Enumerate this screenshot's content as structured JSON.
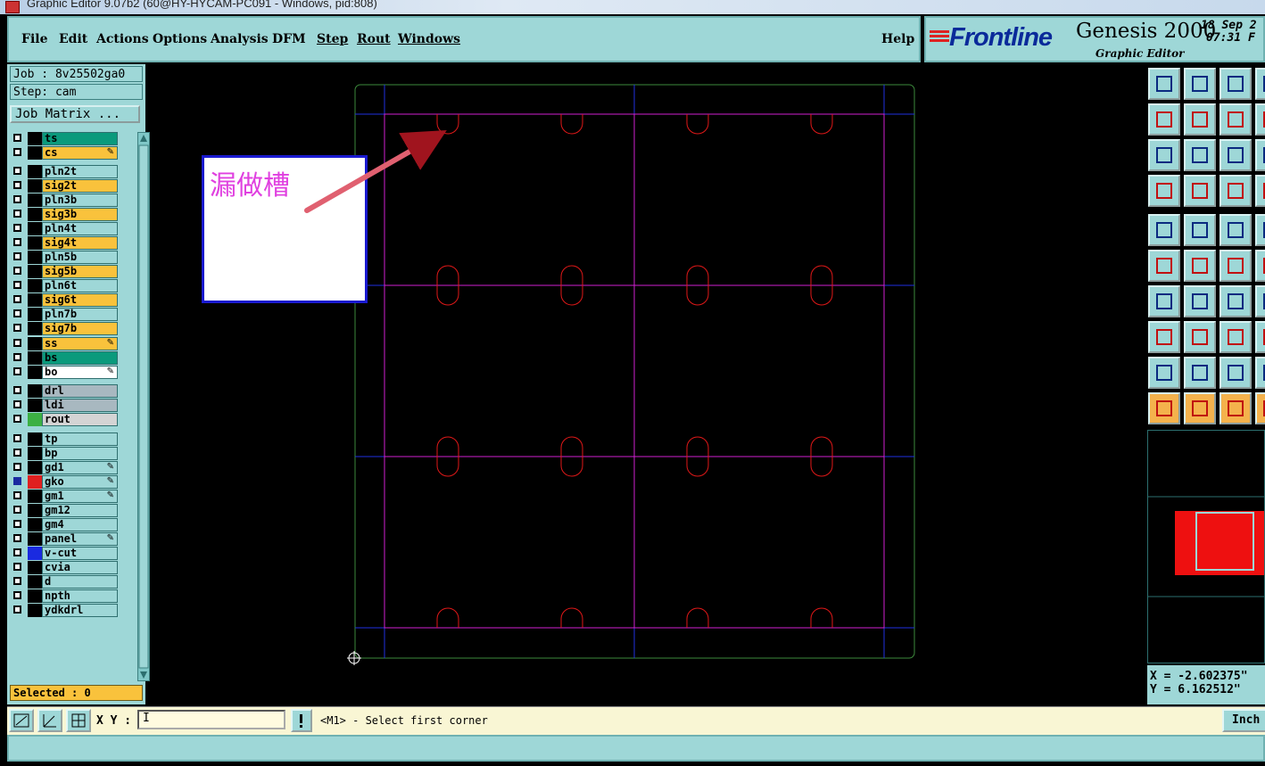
{
  "window": {
    "title": "Graphic Editor 9.07b2 (60@HY-HYCAM-PC091 - Windows, pid:808)"
  },
  "menu": {
    "items": [
      "File",
      "Edit",
      "Actions",
      "Options",
      "Analysis",
      "DFM",
      "Step",
      "Rout",
      "Windows"
    ],
    "help": "Help"
  },
  "brand": {
    "logo": "Frontline",
    "product": "Genesis 2000",
    "subtitle": "Graphic Editor",
    "date": "18 Sep 2",
    "time": "07:31 F"
  },
  "job": {
    "job": "Job : 8v25502ga0",
    "step": "Step: cam",
    "matrix_button": "Job Matrix ..."
  },
  "layers": [
    {
      "name": "ts",
      "color": "#0b9a7c"
    },
    {
      "name": "cs",
      "color": "#f9c23c",
      "edit": true
    },
    {
      "name": "pln2t",
      "color": "#9ed7d7"
    },
    {
      "name": "sig2t",
      "color": "#f9c23c"
    },
    {
      "name": "pln3b",
      "color": "#9ed7d7"
    },
    {
      "name": "sig3b",
      "color": "#f9c23c"
    },
    {
      "name": "pln4t",
      "color": "#9ed7d7"
    },
    {
      "name": "sig4t",
      "color": "#f9c23c"
    },
    {
      "name": "pln5b",
      "color": "#9ed7d7"
    },
    {
      "name": "sig5b",
      "color": "#f9c23c"
    },
    {
      "name": "pln6t",
      "color": "#9ed7d7"
    },
    {
      "name": "sig6t",
      "color": "#f9c23c"
    },
    {
      "name": "pln7b",
      "color": "#9ed7d7"
    },
    {
      "name": "sig7b",
      "color": "#f9c23c"
    },
    {
      "name": "ss",
      "color": "#f9c23c",
      "edit": true
    },
    {
      "name": "bs",
      "color": "#0b9a7c"
    },
    {
      "name": "bo",
      "color": "#ffffff",
      "edit": true
    },
    {
      "name": "drl",
      "color": "#a8b8c0"
    },
    {
      "name": "ldi",
      "color": "#a8b8c0"
    },
    {
      "name": "rout",
      "color": "#d4d4d4",
      "swatch": "#3cb043"
    },
    {
      "name": "tp",
      "color": "#9ed7d7"
    },
    {
      "name": "bp",
      "color": "#9ed7d7"
    },
    {
      "name": "gd1",
      "color": "#9ed7d7",
      "edit": true
    },
    {
      "name": "gko",
      "color": "#9ed7d7",
      "edit": true,
      "swatch": "#e02020",
      "selected": true
    },
    {
      "name": "gm1",
      "color": "#9ed7d7",
      "edit": true
    },
    {
      "name": "gm12",
      "color": "#9ed7d7"
    },
    {
      "name": "gm4",
      "color": "#9ed7d7"
    },
    {
      "name": "panel",
      "color": "#9ed7d7",
      "edit": true
    },
    {
      "name": "v-cut",
      "color": "#9ed7d7",
      "swatch": "#1a2ae0"
    },
    {
      "name": "cvia",
      "color": "#9ed7d7"
    },
    {
      "name": "d",
      "color": "#9ed7d7"
    },
    {
      "name": "npth",
      "color": "#9ed7d7"
    },
    {
      "name": "ydkdrl",
      "color": "#9ed7d7"
    }
  ],
  "selected_label": "Selected : 0",
  "callout": {
    "text": "漏做槽"
  },
  "coords": {
    "x": "X = -2.602375\"",
    "y": "Y = 6.162512\""
  },
  "bottom": {
    "xy_label": "X Y :",
    "xy_value": "I",
    "prompt": "<M1> - Select first corner",
    "units": "Inch"
  },
  "colors": {
    "panel": "#9ed7d7",
    "accent": "#f9c23c",
    "canvas": "#000000",
    "profile": "#3c8a3c",
    "vcut": "#2030e0",
    "route": "#d020d0",
    "slot": "#e01818"
  }
}
